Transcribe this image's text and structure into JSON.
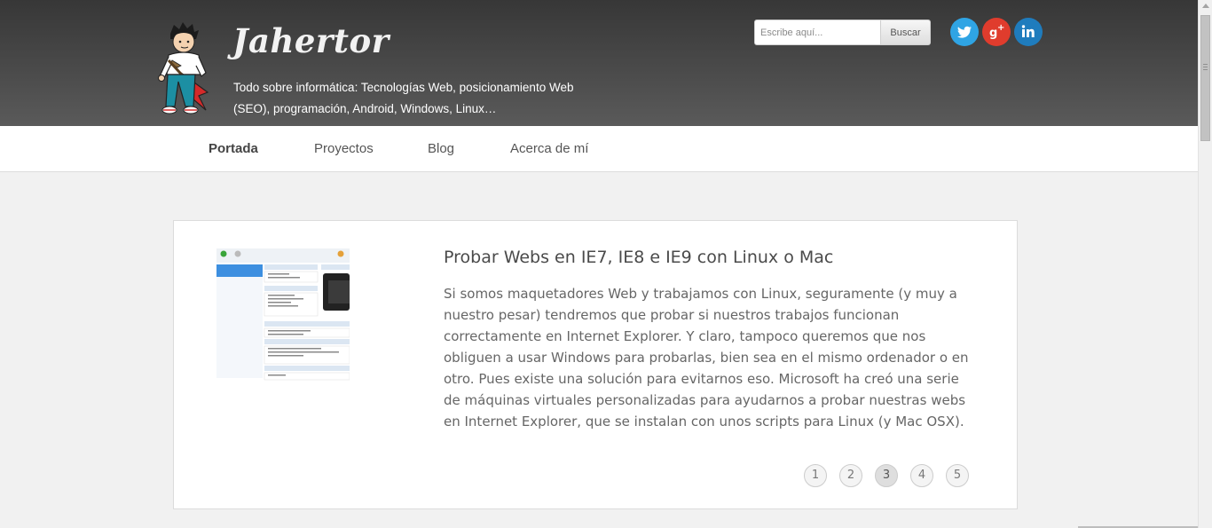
{
  "header": {
    "site_title": "Jahertor",
    "tagline": "Todo sobre informática: Tecnologías Web, posicionamiento Web (SEO), programación, Android, Windows, Linux…",
    "search": {
      "placeholder": "Escribe aquí...",
      "button_label": "Buscar"
    },
    "social": [
      {
        "name": "twitter-icon",
        "color": "#2fa4e4"
      },
      {
        "name": "google-plus-icon",
        "color": "#e03c2d"
      },
      {
        "name": "linkedin-icon",
        "color": "#1f7cbd"
      }
    ]
  },
  "nav": {
    "items": [
      {
        "label": "Portada",
        "active": true
      },
      {
        "label": "Proyectos",
        "active": false
      },
      {
        "label": "Blog",
        "active": false
      },
      {
        "label": "Acerca de mí",
        "active": false
      }
    ]
  },
  "post": {
    "title": "Probar Webs en IE7, IE8 e IE9 con Linux o Mac",
    "excerpt": "Si somos maquetadores Web y trabajamos con Linux, seguramente (y muy a nuestro pesar) tendremos que probar si nuestros trabajos funcionan correctamente en Internet Explorer. Y claro, tampoco queremos que nos obliguen a usar Windows para probarlas, bien sea en el mismo ordenador o en otro. Pues existe una solución para evitarnos eso. Microsoft ha creó una serie de máquinas virtuales personalizadas para ayudarnos a probar nuestras webs en Internet Explorer, que se instalan con unos scripts para Linux (y Mac OSX)."
  },
  "pager": {
    "pages": [
      "1",
      "2",
      "3",
      "4",
      "5"
    ],
    "current": "3"
  }
}
